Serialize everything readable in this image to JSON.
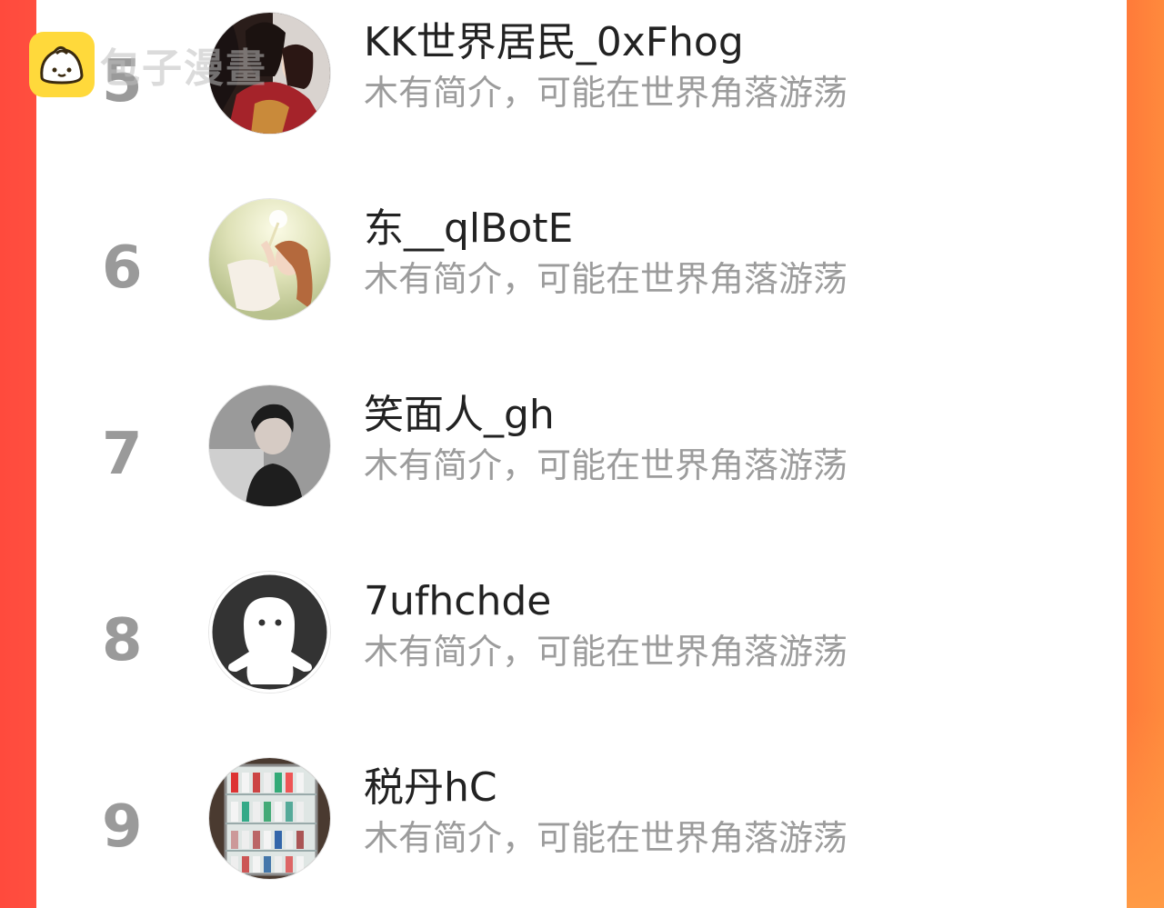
{
  "watermark": {
    "logo_icon": "bun-face-icon",
    "text": "包子漫畫"
  },
  "colors": {
    "left_edge": "#ff4a3d",
    "right_edge": "#ff7a3a",
    "rank_gray": "#9a9a9a",
    "name_dark": "#222222",
    "bio_gray": "#9c9c9c"
  },
  "users": [
    {
      "rank": "5",
      "name": "KK世界居民_0xFhog",
      "bio": "木有简介，可能在世界角落游荡",
      "avatar_icon": "couple-illustration-avatar"
    },
    {
      "rank": "6",
      "name": "东__qlBotE",
      "bio": "木有简介，可能在世界角落游荡",
      "avatar_icon": "girl-with-light-avatar"
    },
    {
      "rank": "7",
      "name": "笑面人_gh",
      "bio": "木有简介，可能在世界角落游荡",
      "avatar_icon": "boy-portrait-avatar"
    },
    {
      "rank": "8",
      "name": "7ufhchde",
      "bio": "木有简介，可能在世界角落游荡",
      "avatar_icon": "default-ghost-avatar"
    },
    {
      "rank": "9",
      "name": "税丹hC",
      "bio": "木有简介，可能在世界角落游荡",
      "avatar_icon": "drinks-fridge-avatar"
    }
  ]
}
